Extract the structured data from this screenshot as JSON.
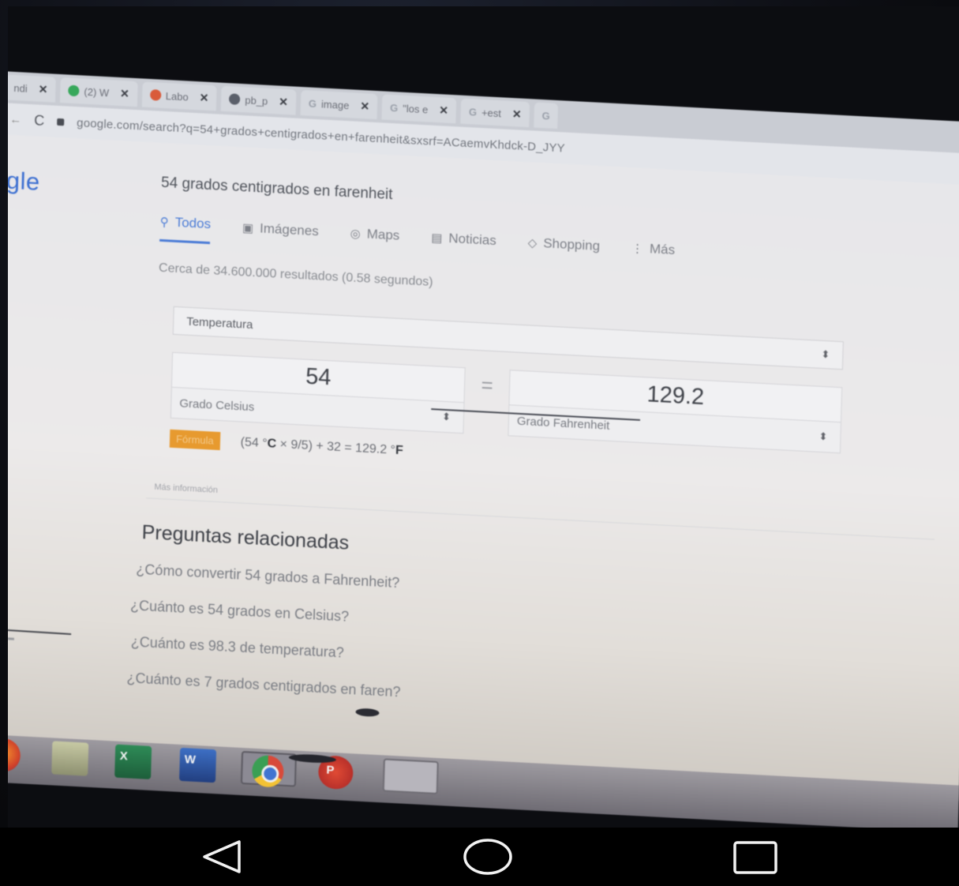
{
  "browser": {
    "tabs": [
      {
        "label": "ndi",
        "icon": "tab-icon",
        "color": "#c9ccd3"
      },
      {
        "label": "(2) W",
        "icon": "whatsapp-icon",
        "color": "#37a85b"
      },
      {
        "label": "Labo",
        "icon": "site-icon",
        "color": "#d95b3a"
      },
      {
        "label": "pb_p",
        "icon": "globe-icon",
        "color": "#5a5f6a"
      },
      {
        "label": "image",
        "icon": "google-icon",
        "color": "#c7c9cf"
      },
      {
        "label": "\"los e",
        "icon": "google-icon",
        "color": "#c7c9cf"
      },
      {
        "label": "+est",
        "icon": "google-icon",
        "color": "#c7c9cf"
      },
      {
        "label": "",
        "icon": "google-icon",
        "color": "#c7c9cf"
      }
    ],
    "url": "google.com/search?q=54+grados+centigrados+en+farenheit&sxsrf=ACaemvKhdck-D_JYY"
  },
  "search": {
    "logo": "ogle",
    "query": "54 grados centigrados en farenheit",
    "nav_tabs": [
      {
        "label": "Todos",
        "icon": "search-icon",
        "active": true
      },
      {
        "label": "Imágenes",
        "icon": "image-icon",
        "active": false
      },
      {
        "label": "Maps",
        "icon": "map-pin-icon",
        "active": false
      },
      {
        "label": "Noticias",
        "icon": "news-icon",
        "active": false
      },
      {
        "label": "Shopping",
        "icon": "tag-icon",
        "active": false
      },
      {
        "label": "Más",
        "icon": "more-vertical-icon",
        "active": false
      }
    ],
    "result_stats": "Cerca de 34.600.000 resultados (0.58 segundos)"
  },
  "converter": {
    "unit_type": "Temperatura",
    "left_value": "54",
    "left_unit": "Grado Celsius",
    "equals": "=",
    "right_value": "129.2",
    "right_unit": "Grado Fahrenheit",
    "formula_label": "Fórmula",
    "formula": {
      "open": "(54 °",
      "c": "C",
      "mid": " × 9/5) + 32 = 129.2 °",
      "f": "F"
    },
    "more_info": "Más información"
  },
  "related_questions": {
    "title": "Preguntas relacionadas",
    "items": [
      "¿Cómo convertir 54 grados a Fahrenheit?",
      "¿Cuánto es 54 grados en Celsius?",
      "¿Cuánto es 98.3 de temperatura?",
      "¿Cuánto es 7 grados centigrados en faren?"
    ]
  },
  "taskbar": {
    "apps": [
      "firefox-icon",
      "file-explorer-icon",
      "excel-icon",
      "word-icon",
      "chrome-icon",
      "powerpoint-icon",
      "media-icon"
    ],
    "excel_letter": "X",
    "word_letter": "W",
    "ppt_letter": "P"
  },
  "android_nav": {
    "buttons": [
      "back-icon",
      "home-icon",
      "recent-apps-icon"
    ]
  }
}
